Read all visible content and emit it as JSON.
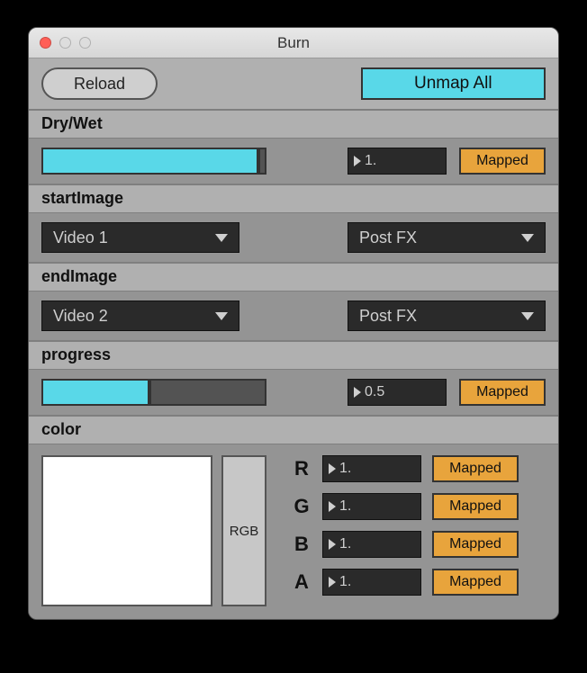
{
  "window": {
    "title": "Burn"
  },
  "toolbar": {
    "reload_label": "Reload",
    "unmap_all_label": "Unmap All"
  },
  "params": {
    "drywet": {
      "label": "Dry/Wet",
      "value_text": "1.",
      "fill_pct": 97,
      "mapped_label": "Mapped"
    },
    "startImage": {
      "label": "startImage",
      "source": "Video 1",
      "stage": "Post FX"
    },
    "endImage": {
      "label": "endImage",
      "source": "Video 2",
      "stage": "Post FX"
    },
    "progress": {
      "label": "progress",
      "value_text": "0.5",
      "fill_pct": 48,
      "mapped_label": "Mapped"
    },
    "color": {
      "label": "color",
      "mode": "RGB",
      "swatch_hex": "#ffffff",
      "channels": [
        {
          "name": "R",
          "value_text": "1.",
          "mapped_label": "Mapped"
        },
        {
          "name": "G",
          "value_text": "1.",
          "mapped_label": "Mapped"
        },
        {
          "name": "B",
          "value_text": "1.",
          "mapped_label": "Mapped"
        },
        {
          "name": "A",
          "value_text": "1.",
          "mapped_label": "Mapped"
        }
      ]
    }
  }
}
